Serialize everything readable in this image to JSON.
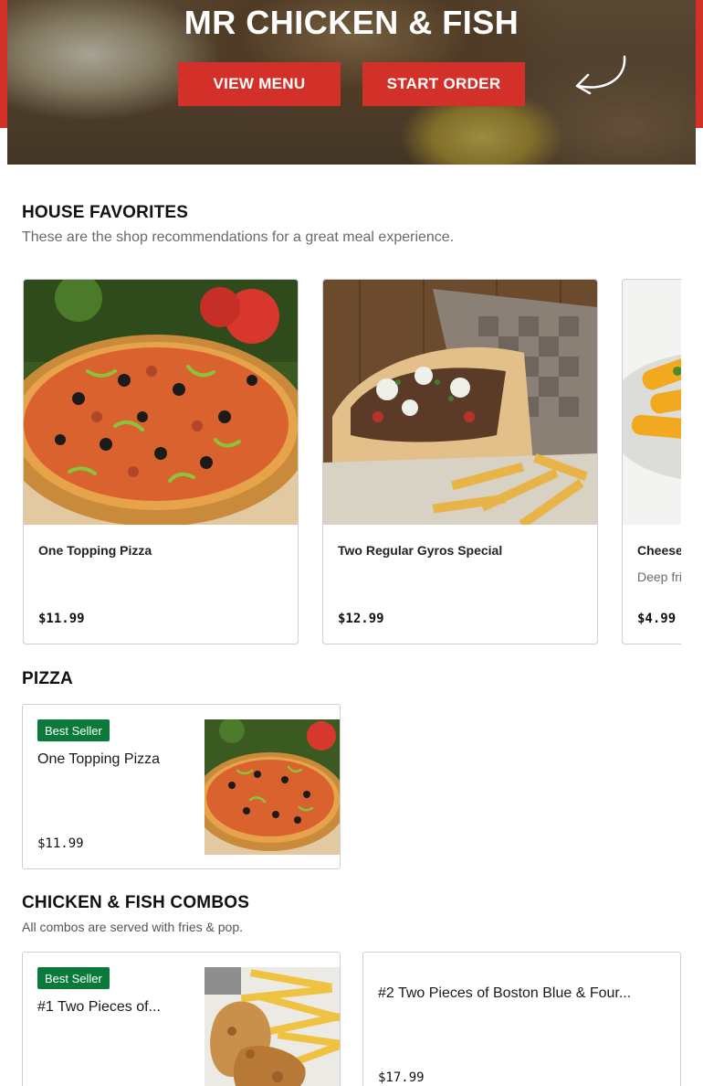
{
  "hero": {
    "title": "MR CHICKEN & FISH",
    "view_menu_label": "VIEW MENU",
    "start_order_label": "START ORDER",
    "accent": "#d4302a"
  },
  "favorites": {
    "title": "HOUSE FAVORITES",
    "description": "These are the shop recommendations for a great meal experience.",
    "items": [
      {
        "name": "One Topping Pizza",
        "description": "",
        "price": "$11.99",
        "image": "pizza-photo"
      },
      {
        "name": "Two Regular Gyros Special",
        "description": "",
        "price": "$12.99",
        "image": "gyros-photo"
      },
      {
        "name": "Cheese",
        "description": "Deep fri outside",
        "price": "$4.99",
        "image": "cheese-sticks-photo"
      }
    ]
  },
  "pizza": {
    "title": "PIZZA",
    "items": [
      {
        "badge": "Best Seller",
        "name": "One Topping Pizza",
        "price": "$11.99",
        "image": "pizza-photo"
      }
    ]
  },
  "combos": {
    "title": "CHICKEN & FISH COMBOS",
    "description": "All combos are served with fries & pop.",
    "items": [
      {
        "badge": "Best Seller",
        "name": "#1 Two Pieces of...",
        "price": "",
        "image": "chicken-fries-photo"
      },
      {
        "badge": "",
        "name": "#2 Two Pieces of Boston Blue & Four...",
        "price": "$17.99",
        "image": ""
      }
    ]
  },
  "colors": {
    "badge_green": "#0a7a3b",
    "border": "#cfcfcf",
    "muted_text": "#6a6a6a"
  }
}
